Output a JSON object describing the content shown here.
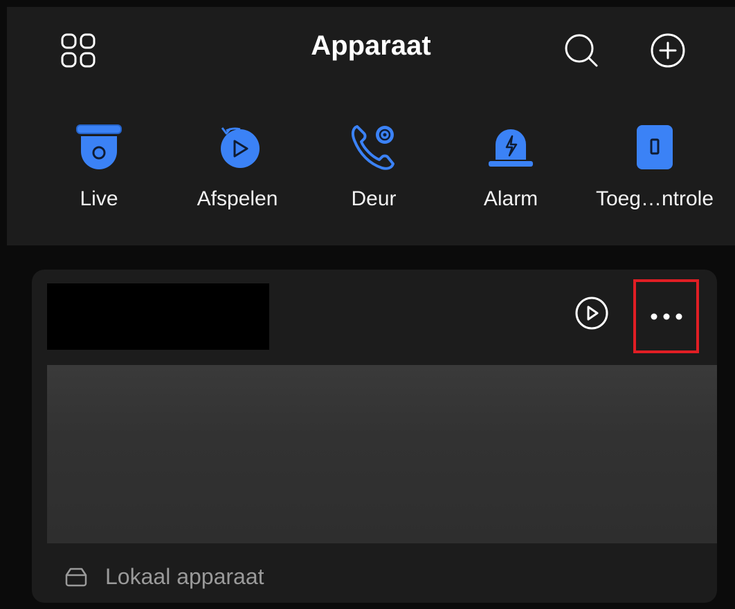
{
  "header": {
    "title": "Apparaat",
    "icons": {
      "menu": "grid-icon",
      "search": "search-icon",
      "add": "plus-circle-icon"
    }
  },
  "quick_actions": [
    {
      "label": "Live",
      "icon": "camera-icon"
    },
    {
      "label": "Afspelen",
      "icon": "playback-icon"
    },
    {
      "label": "Deur",
      "icon": "door-phone-icon"
    },
    {
      "label": "Alarm",
      "icon": "alarm-icon"
    },
    {
      "label": "Toeg…ntrole",
      "icon": "access-control-icon"
    }
  ],
  "device_card": {
    "play_icon": "play-circle-icon",
    "more_icon": "more-dots-icon",
    "footer_label": "Lokaal apparaat",
    "footer_icon": "tray-icon"
  },
  "colors": {
    "accent": "#3b82f6",
    "highlight": "#e01e24",
    "panel": "#1c1c1c",
    "background": "#0b0b0b"
  }
}
